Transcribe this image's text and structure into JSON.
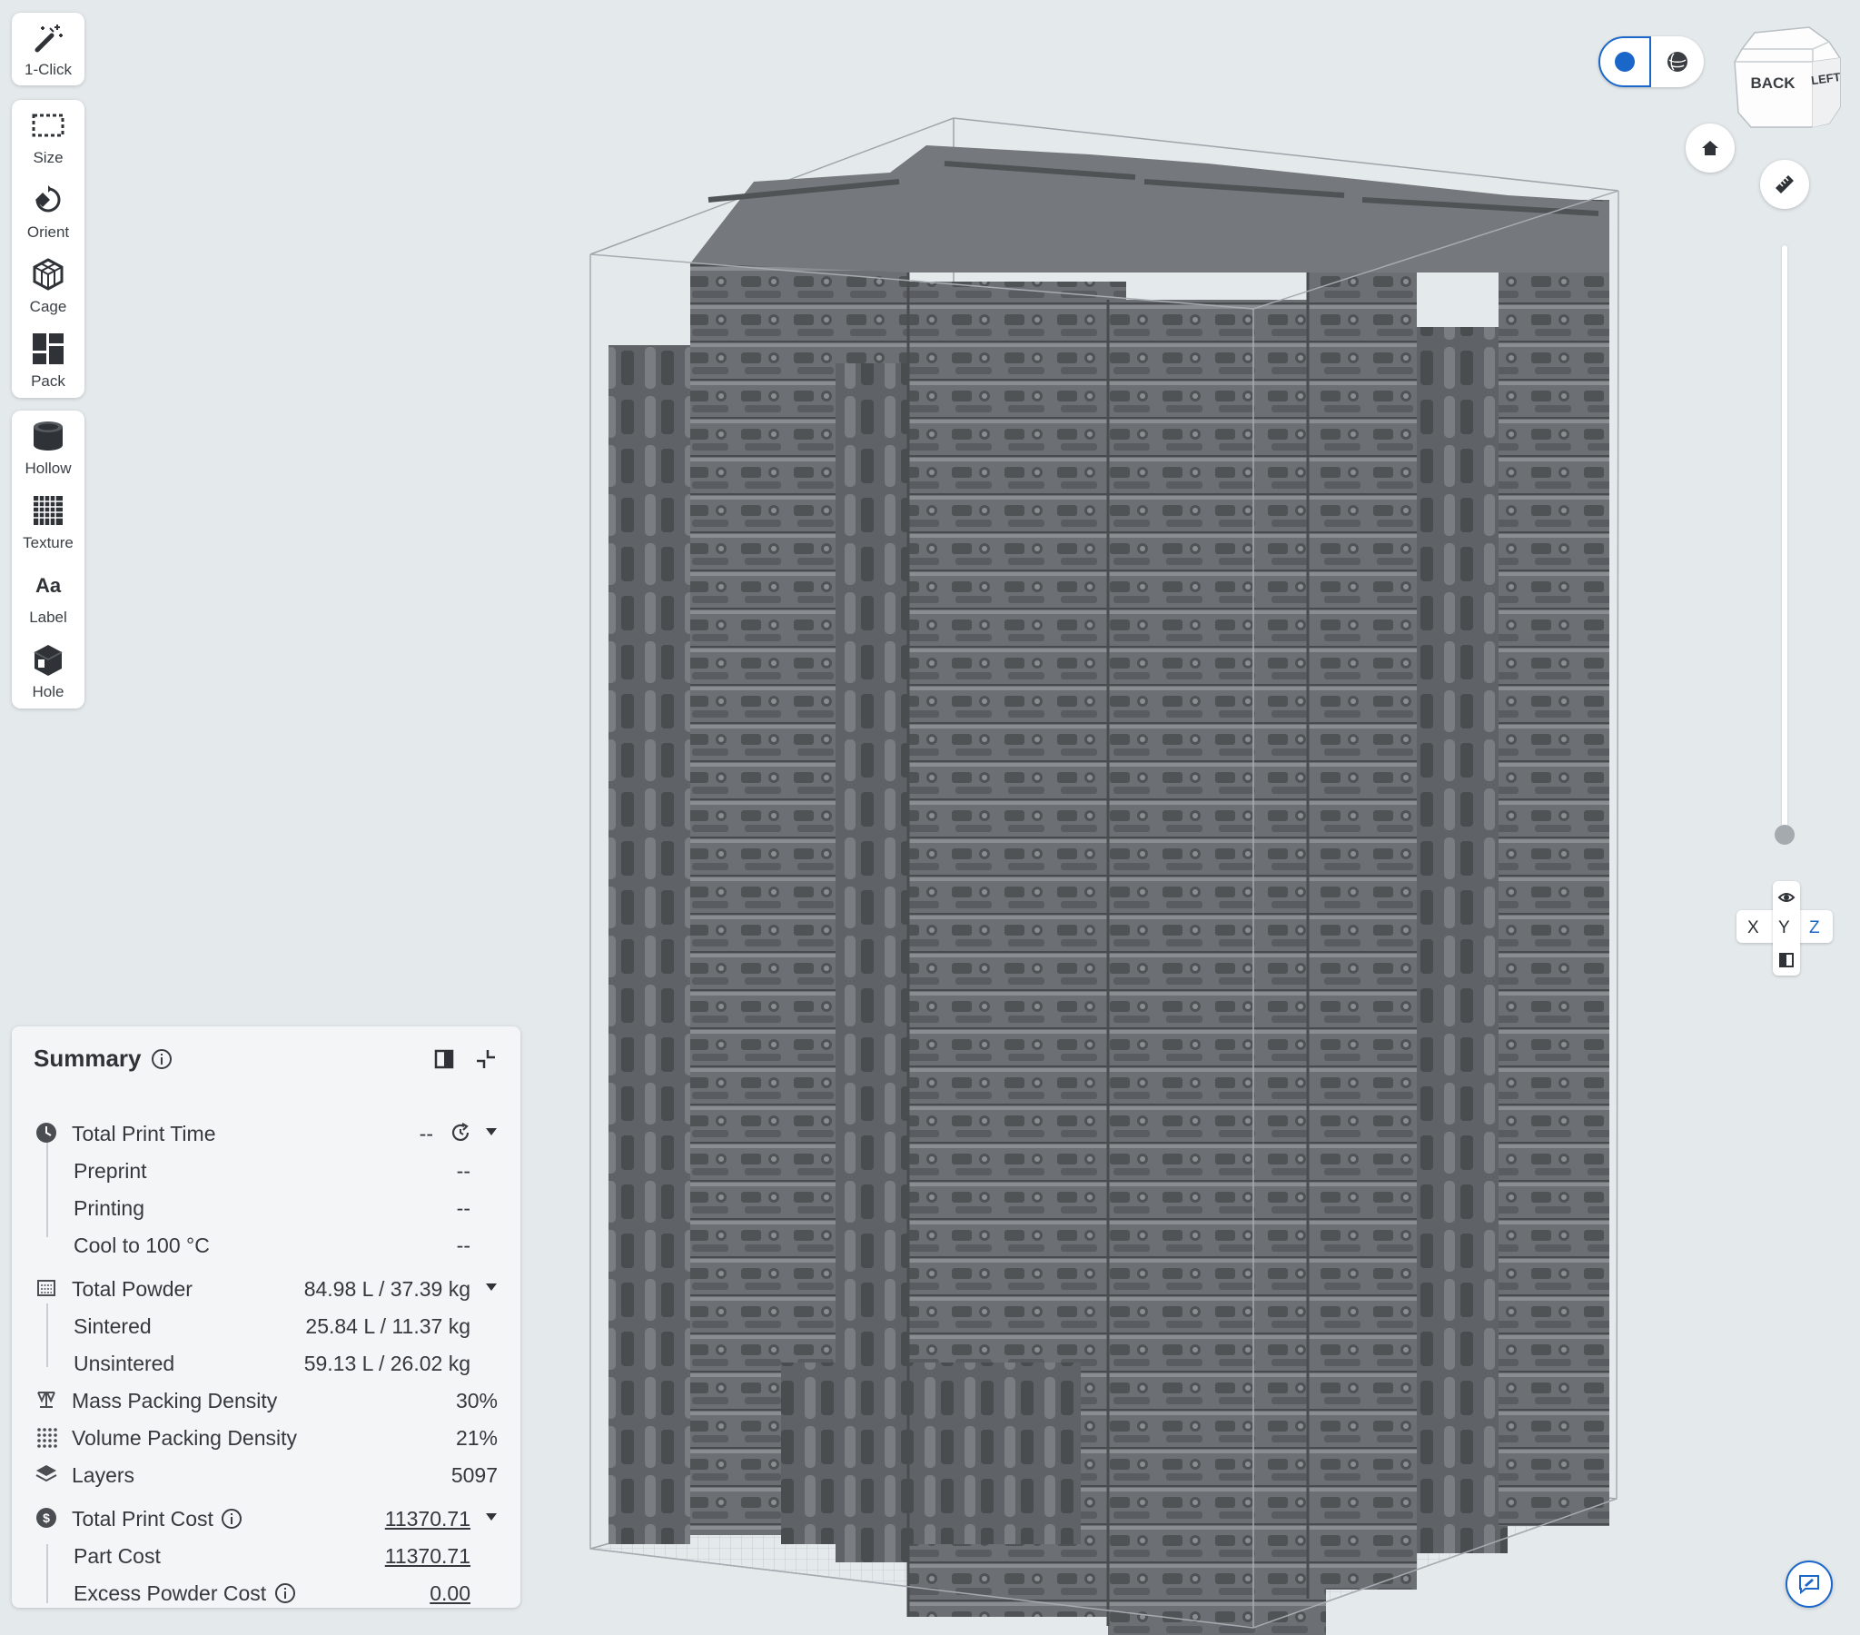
{
  "toolbar": {
    "group1": [
      {
        "label": "1-Click",
        "icon": "magic-wand-icon"
      }
    ],
    "group2": [
      {
        "label": "Size",
        "icon": "size-icon"
      },
      {
        "label": "Orient",
        "icon": "orient-icon"
      },
      {
        "label": "Cage",
        "icon": "cage-icon"
      },
      {
        "label": "Pack",
        "icon": "pack-icon"
      }
    ],
    "group3": [
      {
        "label": "Hollow",
        "icon": "hollow-icon"
      },
      {
        "label": "Texture",
        "icon": "texture-icon"
      },
      {
        "label": "Label",
        "icon": "label-icon"
      },
      {
        "label": "Hole",
        "icon": "hole-icon"
      }
    ]
  },
  "summary": {
    "title": "Summary",
    "total_print_time": {
      "label": "Total Print Time",
      "value": "--"
    },
    "preprint": {
      "label": "Preprint",
      "value": "--"
    },
    "printing": {
      "label": "Printing",
      "value": "--"
    },
    "cool": {
      "label": "Cool to 100 °C",
      "value": "--"
    },
    "total_powder": {
      "label": "Total Powder",
      "value": "84.98 L / 37.39 kg"
    },
    "sintered": {
      "label": "Sintered",
      "value": "25.84 L / 11.37 kg"
    },
    "unsintered": {
      "label": "Unsintered",
      "value": "59.13 L / 26.02 kg"
    },
    "mass_density": {
      "label": "Mass Packing Density",
      "value": "30%"
    },
    "volume_density": {
      "label": "Volume Packing Density",
      "value": "21%"
    },
    "layers": {
      "label": "Layers",
      "value": "5097"
    },
    "total_cost": {
      "label": "Total Print Cost",
      "value": "11370.71"
    },
    "part_cost": {
      "label": "Part Cost",
      "value": "11370.71"
    },
    "excess_cost": {
      "label": "Excess Powder Cost",
      "value": "0.00"
    }
  },
  "view_cube": {
    "face_front": "BACK",
    "face_side": "LEFT"
  },
  "axes": {
    "x": "X",
    "y": "Y",
    "z": "Z"
  },
  "colors": {
    "accent": "#1b67c9",
    "part": "#6e7175",
    "background": "#e4e9ec"
  }
}
